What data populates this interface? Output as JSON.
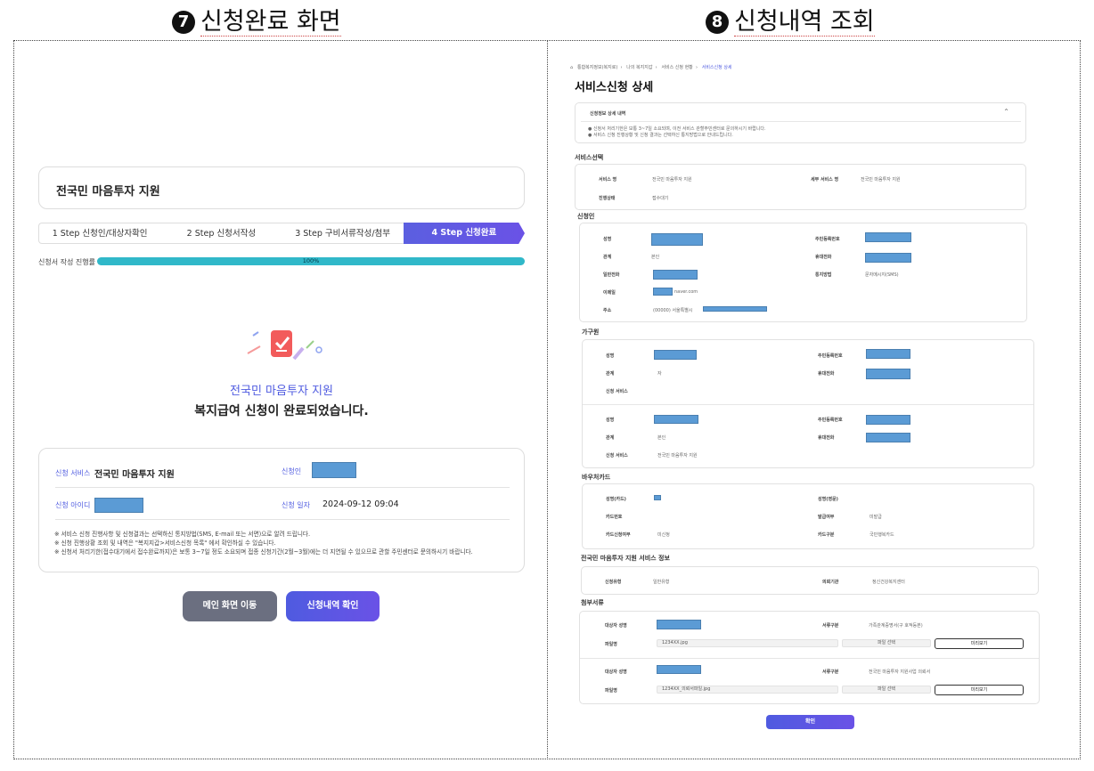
{
  "headers": {
    "left": {
      "num": "7",
      "title": "신청완료 화면"
    },
    "right": {
      "num": "8",
      "title": "신청내역 조회"
    }
  },
  "left": {
    "service_title": "전국민 마음투자 지원",
    "steps": [
      "1 Step 신청인/대상자확인",
      "2 Step 신청서작성",
      "3 Step 구비서류작성/첨부",
      "4 Step 신청완료"
    ],
    "progress": {
      "label": "신청서 작성 진행률",
      "value": 100,
      "text": "100%"
    },
    "complete_service": "전국민 마음투자 지원",
    "complete_message": "복지급여 신청이 완료되었습니다.",
    "info": {
      "service_label": "신청 서비스",
      "service_value": "전국민 마음투자 지원",
      "applicant_label": "신청인",
      "id_label": "신청 아이디",
      "date_label": "신청 일자",
      "date_value": "2024-09-12 09:04"
    },
    "notes": [
      "※ 서비스 신청 진행사항 및 신청결과는 선택하신 통지방법(SMS, E-mail 또는 서면)으로 알려 드립니다.",
      "※ 신청 진행상황 조회 및 내역은 \"복지지갑>서비스신청 목록\" 에서 확인하실 수 있습니다.",
      "※ 신청서 처리기한(접수대기에서 접수완료까지)은 보통 3~7일 정도 소요되며 접종 신청기간(2월~3월)에는 더 지연될 수 있으므로 관할 주민센터로 문의하시기 바랍니다."
    ],
    "btn_main": "메인 화면 이동",
    "btn_history": "신청내역 확인"
  },
  "right": {
    "breadcrumb": [
      "통합복지정보(복지로)",
      "나의 복지지갑",
      "서비스 신청 현황",
      "서비스신청 상세"
    ],
    "title": "서비스신청 상세",
    "notice": {
      "title": "신청정보 상세 내역",
      "lines": [
        "● 신청서 처리기한은 보통 3~7일 소요되며, 이전 서비스 관할주민센터로 문의하시기 바랍니다.",
        "● 서비스 신청 진행상황 및 신청 결과는 선택하신 통지방법으로 안내드립니다."
      ]
    },
    "svc_section": "서비스선택",
    "svc": {
      "name_label": "서비스 명",
      "name_value": "전국민 마음투자 지원",
      "name2_label": "세부 서비스 명",
      "name2_value": "전국민 마음투자 지원",
      "status_label": "진행상태",
      "status_value": "접수대기"
    },
    "applicant_section": "신청인",
    "applicant": {
      "name": "성명",
      "rrn": "주민등록번호",
      "relation": "관계",
      "relation_value": "본인",
      "mobile": "휴대전화",
      "phone": "일반전화",
      "notify": "통지방법",
      "notify_value": "문자메시지(SMS)",
      "email": "이메일",
      "email_value": "naver.com",
      "address": "주소",
      "address_value": "(00000) 서울특별시"
    },
    "household_section": "가구원",
    "household": [
      {
        "name": "성명",
        "rrn": "주민등록번호",
        "relation": "관계",
        "relation_value": "자",
        "mobile": "휴대전화",
        "service": "신청 서비스",
        "service_value": ""
      },
      {
        "name": "성명",
        "rrn": "주민등록번호",
        "relation": "관계",
        "relation_value": "본인",
        "mobile": "휴대전화",
        "service": "신청 서비스",
        "service_value": "전국민 마음투자 지원"
      }
    ],
    "voucher_section": "바우처카드",
    "voucher": {
      "holder": "성명(카드)",
      "holder2": "성명(영문)",
      "card_no": "카드번호",
      "issue": "발급여부",
      "issue_value": "미발급",
      "new": "카드신청여부",
      "new_value": "미신청",
      "type": "카드구분",
      "type_value": "국민행복카드"
    },
    "mind_section": "전국민 마음투자 지원 서비스 정보",
    "mind": {
      "type": "신청유형",
      "type_value": "일반유형",
      "org": "의뢰기관",
      "org_value": "정신건강복지센터"
    },
    "docs_section": "첨부서류",
    "docs": [
      {
        "target": "대상자 성명",
        "kind": "서류구분",
        "kind_value": "가족관계증명서(구 호적등본)",
        "file": "파일명",
        "file_value": "1234XX.jpg",
        "select": "파일 선택",
        "view": "미리보기"
      },
      {
        "target": "대상자 성명",
        "kind": "서류구분",
        "kind_value": "전국민 마음투자 지원사업 의뢰서",
        "file": "파일명",
        "file_value": "1234XX_의뢰서파일.jpg",
        "select": "파일 선택",
        "view": "미리보기"
      }
    ],
    "confirm": "확인"
  },
  "colors": {
    "accent": "#4f5be0",
    "progress": "#30b8c9",
    "redaction": "#5b9bd5",
    "btn_gray": "#6b6f80"
  }
}
